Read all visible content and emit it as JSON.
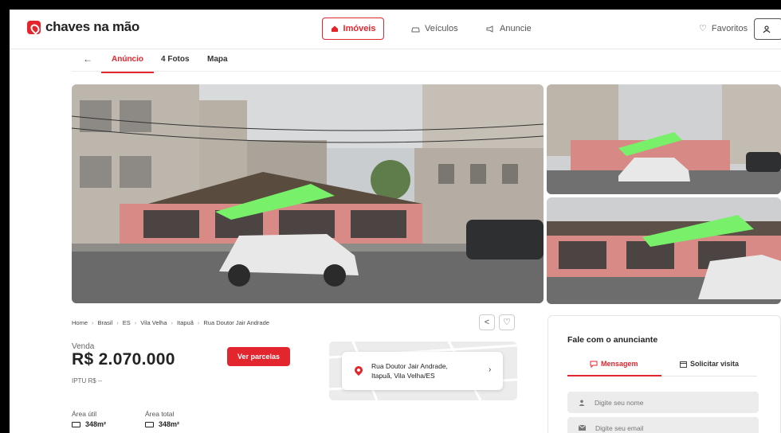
{
  "header": {
    "logo_text": "chaves na mão",
    "nav": [
      {
        "label": "Imóveis",
        "icon": "house-icon"
      },
      {
        "label": "Veículos",
        "icon": "car-icon"
      },
      {
        "label": "Anuncie",
        "icon": "megaphone-icon"
      }
    ],
    "favorites_label": "Favoritos"
  },
  "tabs": {
    "back_icon": "←",
    "items": [
      "Anúncio",
      "4 Fotos",
      "Mapa"
    ]
  },
  "breadcrumb": [
    "Home",
    "Brasil",
    "ES",
    "Vila Velha",
    "Itapuã",
    "Rua Doutor Jair Andrade"
  ],
  "listing": {
    "type_label": "Venda",
    "price": "R$ 2.070.000",
    "iptu": "IPTU R$ --",
    "installments_button": "Ver parcelas",
    "useful_area_label": "Área útil",
    "useful_area_value": "348m²",
    "total_area_label": "Área total",
    "total_area_value": "348m²"
  },
  "map": {
    "address_line1": "Rua Doutor Jair Andrade,",
    "address_line2": "Itapuã, Vila Velha/ES"
  },
  "contact": {
    "title": "Fale com o anunciante",
    "tab_message": "Mensagem",
    "tab_visit": "Solicitar visita",
    "name_placeholder": "Digite seu nome",
    "email_placeholder": "Digite seu email"
  },
  "colors": {
    "brand": "#e3262e"
  }
}
